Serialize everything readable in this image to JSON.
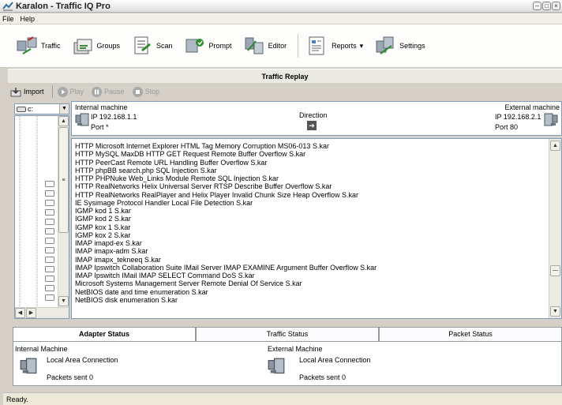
{
  "window": {
    "title": "Karalon - Traffic IQ Pro"
  },
  "menu": [
    "File",
    "Help"
  ],
  "toolbar": {
    "items": [
      {
        "label": "Traffic",
        "icon": "traffic-icon"
      },
      {
        "label": "Groups",
        "icon": "groups-icon"
      },
      {
        "label": "Scan",
        "icon": "scan-icon"
      },
      {
        "label": "Prompt",
        "icon": "prompt-icon"
      },
      {
        "label": "Editor",
        "icon": "editor-icon"
      },
      {
        "label": "Reports",
        "icon": "reports-icon"
      },
      {
        "label": "Settings",
        "icon": "settings-icon"
      }
    ]
  },
  "replay": {
    "title": "Traffic Replay",
    "import_label": "Import",
    "play_label": "Play",
    "pause_label": "Pause",
    "stop_label": "Stop"
  },
  "drive": {
    "value": "c:"
  },
  "machines": {
    "internal_label": "Internal machine",
    "internal_ip": "IP 192.168.1.1",
    "internal_port": "Port *",
    "direction_label": "Direction",
    "direction_arrow": "➔",
    "external_label": "External machine",
    "external_ip": "IP 192.168.2.1",
    "external_port": "Port 80"
  },
  "attacks": [
    "HTTP Microsoft Internet Explorer HTML Tag Memory Corruption MS06-013 S.kar",
    "HTTP MySQL MaxDB HTTP GET Request Remote Buffer Overflow S.kar",
    "HTTP PeerCast Remote URL Handling Buffer Overflow S.kar",
    "HTTP phpBB search.php SQL Injection S.kar",
    "HTTP PHPNuke Web_Links Module Remote SQL Injection S.kar",
    "HTTP RealNetworks Helix Universal Server RTSP Describe Buffer Overflow S.kar",
    "HTTP RealNetworks RealPlayer and Helix Player Invalid Chunk Size Heap Overflow S.kar",
    "IE Sysimage Protocol Handler Local File Detection S.kar",
    "IGMP kod 1 S.kar",
    "IGMP kod 2 S.kar",
    "IGMP kox 1 S.kar",
    "IGMP kox 2 S.kar",
    "IMAP imapd-ex S.kar",
    "IMAP imapx-adm S.kar",
    "IMAP imapx_tekneeq S.kar",
    "IMAP Ipswitch Collaboration Suite IMail Server IMAP EXAMINE Argument Buffer Overflow S.kar",
    "IMAP Ipswitch IMail IMAP SELECT Command DoS S.kar",
    "Microsoft Systems Management Server Remote Denial Of Service S.kar",
    "NetBIOS date and time enumeration S.kar",
    "NetBIOS disk enumeration S.kar"
  ],
  "tabs": [
    "Adapter Status",
    "Traffic Status",
    "Packet Status"
  ],
  "adapter": {
    "internal_title": "Internal Machine",
    "internal_conn": "Local Area Connection",
    "internal_packets": "Packets sent 0",
    "external_title": "External Machine",
    "external_conn": "Local Area Connection",
    "external_packets": "Packets sent 0"
  },
  "status": {
    "text": "Ready."
  }
}
